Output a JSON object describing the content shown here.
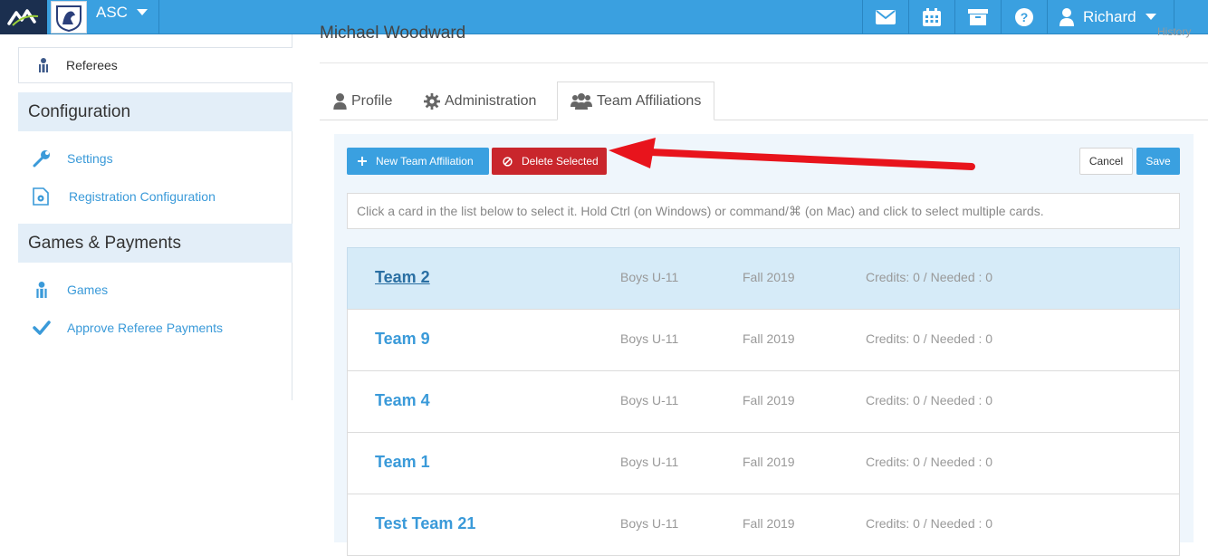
{
  "topbar": {
    "org_name": "ASC",
    "user_name": "Richard",
    "icons": [
      "mail-icon",
      "calendar-icon",
      "archive-icon",
      "help-icon",
      "user-icon"
    ]
  },
  "sidebar": {
    "active_item": "Referees",
    "sections": [
      {
        "header": "Configuration",
        "items": [
          "Settings",
          "Registration Configuration"
        ]
      },
      {
        "header": "Games & Payments",
        "items": [
          "Games",
          "Approve Referee Payments"
        ]
      }
    ]
  },
  "main": {
    "title": "Michael Woodward",
    "history_link": "History",
    "tabs": [
      {
        "label": "Profile",
        "icon": "user-icon"
      },
      {
        "label": "Administration",
        "icon": "gear-icon"
      },
      {
        "label": "Team Affiliations",
        "icon": "users-icon",
        "active": true
      }
    ],
    "toolbar": {
      "new_label": "New Team Affiliation",
      "delete_label": "Delete Selected",
      "cancel_label": "Cancel",
      "save_label": "Save"
    },
    "hint": "Click a card in the list below to select it. Hold Ctrl (on Windows) or command/⌘ (on Mac) and click to select multiple cards.",
    "cards": [
      {
        "name": "Team 2",
        "division": "Boys U-11",
        "season": "Fall 2019",
        "credits": "Credits: 0 / Needed : 0",
        "selected": true
      },
      {
        "name": "Team 9",
        "division": "Boys U-11",
        "season": "Fall 2019",
        "credits": "Credits: 0 / Needed : 0"
      },
      {
        "name": "Team 4",
        "division": "Boys U-11",
        "season": "Fall 2019",
        "credits": "Credits: 0 / Needed : 0"
      },
      {
        "name": "Team 1",
        "division": "Boys U-11",
        "season": "Fall 2019",
        "credits": "Credits: 0 / Needed : 0"
      },
      {
        "name": "Test Team 21",
        "division": "Boys U-11",
        "season": "Fall 2019",
        "credits": "Credits: 0 / Needed : 0"
      }
    ]
  },
  "colors": {
    "primary": "#3aa0e0",
    "danger": "#c9262c",
    "selected_card": "#d6ebf8",
    "arrow": "#e8141c"
  }
}
